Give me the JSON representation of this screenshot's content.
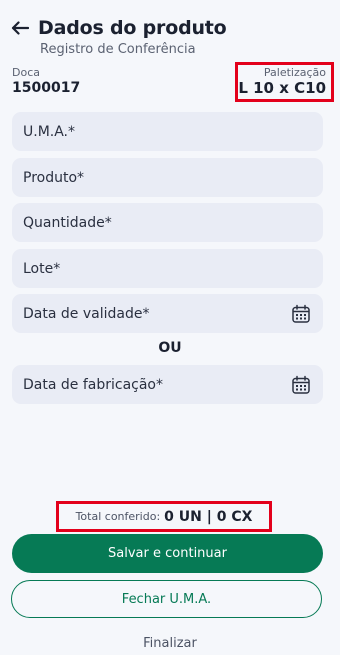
{
  "header": {
    "title": "Dados do produto",
    "subtitle": "Registro de Conferência",
    "back_icon": "arrow-left-icon"
  },
  "info": {
    "doca_label": "Doca",
    "doca_value": "1500017",
    "paletizacao_label": "Paletização",
    "paletizacao_value": "L 10 x C10"
  },
  "form": {
    "uma_label": "U.M.A.*",
    "produto_label": "Produto*",
    "quantidade_label": "Quantidade*",
    "lote_label": "Lote*",
    "validade_label": "Data de validade*",
    "separator": "OU",
    "fabricacao_label": "Data de fabricação*",
    "calendar_icon": "calendar-icon"
  },
  "summary": {
    "total_label": "Total conferido:",
    "total_value": "0 UN | 0 CX"
  },
  "actions": {
    "primary_label": "Salvar e continuar",
    "secondary_label": "Fechar U.M.A.",
    "link_label": "Finalizar"
  },
  "colors": {
    "accent": "#067a55",
    "highlight_border": "#e3001b",
    "field_background": "#e9ecf5",
    "page_background": "#f5f7fb"
  }
}
